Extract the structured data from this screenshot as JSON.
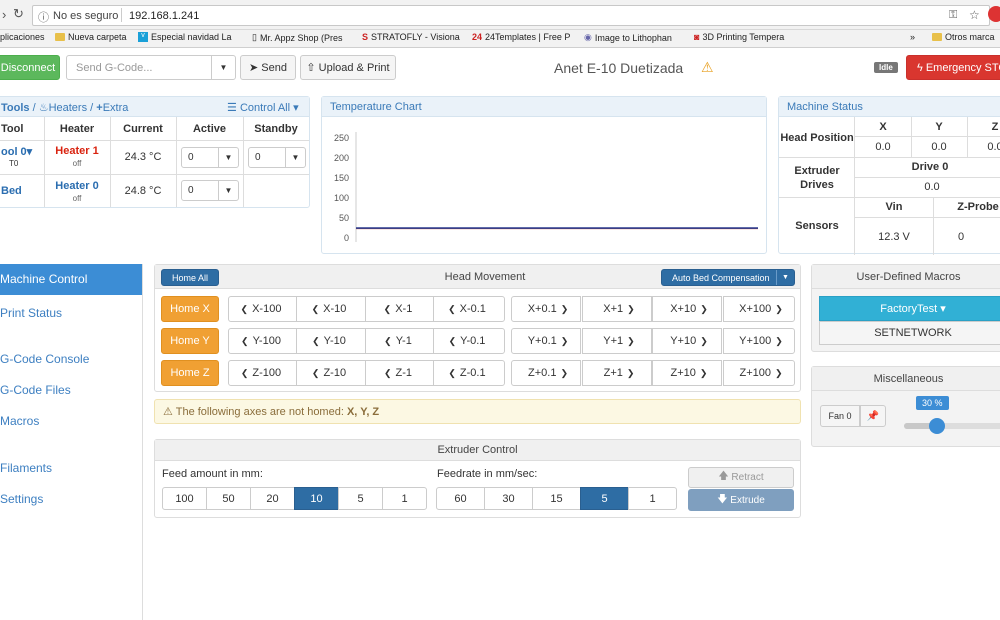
{
  "browser": {
    "security_label": "No es seguro",
    "url": "192.168.1.241",
    "bookmarks": [
      "plicaciones",
      "Nueva carpeta",
      "Especial navidad La",
      "Mr. Appz Shop (Pres",
      "STRATOFLY - Visiona",
      "24Templates | Free P",
      "Image to Lithophan",
      "3D Printing Tempera"
    ],
    "more": "»",
    "other_bookmarks": "Otros marca"
  },
  "toolbar": {
    "disconnect": "Disconnect",
    "gcode_placeholder": "Send G-Code...",
    "send": "Send",
    "upload": "Upload & Print",
    "printer_name": "Anet E-10 Duetizada",
    "status": "Idle",
    "emergency": "Emergency STO"
  },
  "tools_panel": {
    "tools": "Tools",
    "heaters": "Heaters",
    "extra": "Extra",
    "control_all": "Control All",
    "headers": [
      "Tool",
      "Heater",
      "Current",
      "Active",
      "Standby"
    ],
    "rows": [
      {
        "tool": "ool 0",
        "sub": "T0",
        "heater": "Heater 1",
        "heater_state": "off",
        "current": "24.3 °C",
        "active": "0",
        "standby": "0"
      },
      {
        "tool": "Bed",
        "sub": "",
        "heater": "Heater 0",
        "heater_state": "off",
        "current": "24.8 °C",
        "active": "0",
        "standby": ""
      }
    ]
  },
  "temp_chart": {
    "title": "Temperature Chart"
  },
  "chart_data": {
    "type": "line",
    "ylim": [
      0,
      260
    ],
    "y_ticks": [
      "250",
      "200",
      "150",
      "100",
      "50",
      "0"
    ],
    "series": [
      {
        "color": "#c0392b",
        "values": [
          24.3,
          24.3,
          24.3,
          24.3,
          24.3
        ]
      },
      {
        "color": "#2b3c8f",
        "values": [
          24.8,
          24.8,
          24.8,
          24.8,
          24.8
        ]
      }
    ]
  },
  "machine_status": {
    "title": "Machine Status",
    "head_position": "Head Position",
    "axes": [
      "X",
      "Y",
      "Z"
    ],
    "pos": [
      "0.0",
      "0.0",
      "0.0"
    ],
    "extruder_drives": "Extruder Drives",
    "drive_label": "Drive 0",
    "drive_value": "0.0",
    "sensors": "Sensors",
    "vin_label": "Vin",
    "vin_value": "12.3 V",
    "zprobe_label": "Z-Probe",
    "zprobe_value": "0"
  },
  "sidebar": [
    "Machine Control",
    "Print Status",
    "G-Code Console",
    "G-Code Files",
    "Macros",
    "Filaments",
    "Settings"
  ],
  "head_movement": {
    "title": "Head Movement",
    "home_all": "Home All",
    "abc": "Auto Bed Compensation",
    "home": [
      "Home X",
      "Home Y",
      "Home Z"
    ],
    "rows": [
      [
        "X-100",
        "X-10",
        "X-1",
        "X-0.1",
        "X+0.1",
        "X+1",
        "X+10",
        "X+100"
      ],
      [
        "Y-100",
        "Y-10",
        "Y-1",
        "Y-0.1",
        "Y+0.1",
        "Y+1",
        "Y+10",
        "Y+100"
      ],
      [
        "Z-100",
        "Z-10",
        "Z-1",
        "Z-0.1",
        "Z+0.1",
        "Z+1",
        "Z+10",
        "Z+100"
      ]
    ]
  },
  "warning": {
    "text": "The following axes are not homed:",
    "axes": "X, Y, Z"
  },
  "extruder": {
    "title": "Extruder Control",
    "feed_label": "Feed amount in mm:",
    "feed": [
      "100",
      "50",
      "20",
      "10",
      "5",
      "1"
    ],
    "feed_sel": "10",
    "rate_label": "Feedrate in mm/sec:",
    "rate": [
      "60",
      "30",
      "15",
      "5",
      "1"
    ],
    "rate_sel": "5",
    "retract": "Retract",
    "extrude": "Extrude"
  },
  "macros": {
    "title": "User-Defined Macros",
    "factory": "FactoryTest",
    "setnetwork": "SETNETWORK"
  },
  "misc": {
    "title": "Miscellaneous",
    "fan": "Fan 0",
    "fan_value": "30 %",
    "fan_fraction": 0.3
  }
}
